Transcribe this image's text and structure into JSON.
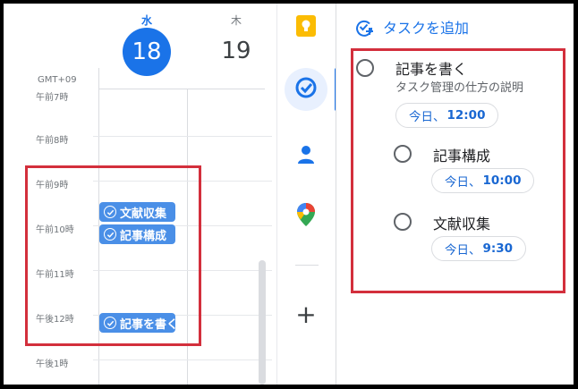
{
  "calendar": {
    "days": [
      {
        "dow": "水",
        "date": "18",
        "today": true
      },
      {
        "dow": "木",
        "date": "19",
        "today": false
      }
    ],
    "timezone": "GMT+09",
    "hours": [
      "午前7時",
      "午前8時",
      "午前9時",
      "午前10時",
      "午前11時",
      "午後12時",
      "午後1時"
    ],
    "events": [
      {
        "title": "文献収集"
      },
      {
        "title": "記事構成"
      },
      {
        "title": "記事を書く"
      }
    ]
  },
  "tasks_panel": {
    "add_task_label": "タスクを追加",
    "tasks": [
      {
        "title": "記事を書く",
        "description": "タスク管理の仕方の説明",
        "due_day": "今日、",
        "due_time": "12:00"
      },
      {
        "title": "記事構成",
        "due_day": "今日、",
        "due_time": "10:00"
      },
      {
        "title": "文献収集",
        "due_day": "今日、",
        "due_time": "9:30"
      }
    ]
  },
  "side_rail": {
    "icons": [
      "keep-icon",
      "tasks-icon",
      "contacts-icon",
      "maps-icon",
      "add-icon"
    ]
  },
  "colors": {
    "accent": "#1a73e8",
    "event": "#4a8fe7",
    "highlight_box": "#d32f3c"
  }
}
